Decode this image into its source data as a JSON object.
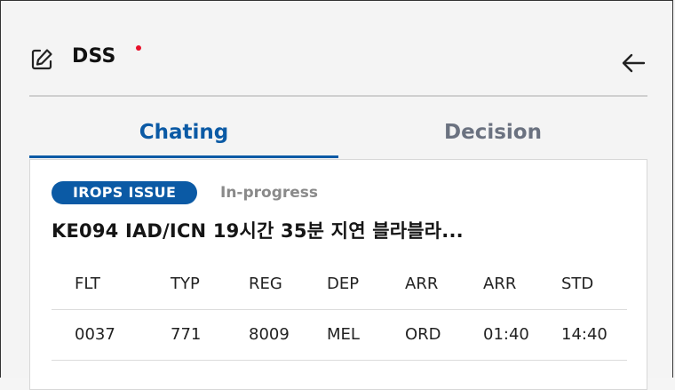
{
  "header": {
    "title": "DSS",
    "edit_icon": "edit-icon",
    "back_icon": "arrow-left-icon",
    "notification_color": "#e8102a"
  },
  "tabs": [
    {
      "label": "Chating",
      "active": true
    },
    {
      "label": "Decision",
      "active": false
    }
  ],
  "colors": {
    "accent": "#0b5aa5",
    "inactive_tab": "#6b7280",
    "badge_bg": "#0b5aa5"
  },
  "issue": {
    "badge": "IROPS ISSUE",
    "status": "In-progress",
    "title": "KE094 IAD/ICN 19시간 35분 지연 블라블라..."
  },
  "flight_table": {
    "headers": [
      "FLT",
      "TYP",
      "REG",
      "DEP",
      "ARR",
      "ARR",
      "STD"
    ],
    "rows": [
      [
        "0037",
        "771",
        "8009",
        "MEL",
        "ORD",
        "01:40",
        "14:40"
      ]
    ]
  }
}
